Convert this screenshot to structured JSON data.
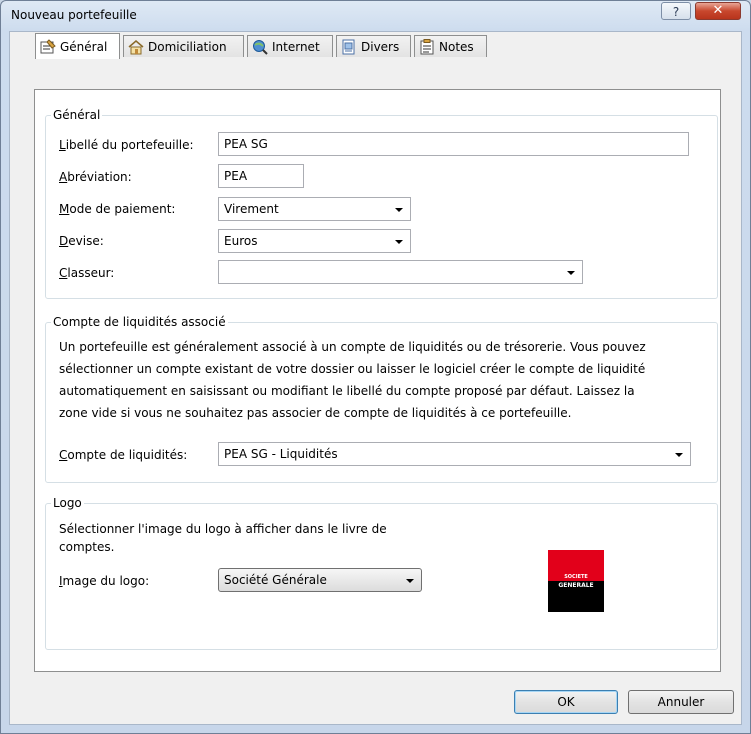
{
  "window": {
    "title": "Nouveau portefeuille",
    "help_label": "?",
    "close_label": "✕"
  },
  "tabs": [
    {
      "label": "Général",
      "icon": "general-icon",
      "active": true
    },
    {
      "label": "Domiciliation",
      "icon": "house-icon",
      "active": false
    },
    {
      "label": "Internet",
      "icon": "internet-icon",
      "active": false
    },
    {
      "label": "Divers",
      "icon": "divers-icon",
      "active": false
    },
    {
      "label": "Notes",
      "icon": "notes-icon",
      "active": false
    }
  ],
  "general": {
    "title": "Général",
    "libelle": {
      "label_hot": "L",
      "label_rest": "ibellé du portefeuille:",
      "value": "PEA SG"
    },
    "abreviation": {
      "label_hot": "A",
      "label_rest": "bréviation:",
      "value": "PEA"
    },
    "mode_paiement": {
      "label_hot": "M",
      "label_rest": "ode de paiement:",
      "value": "Virement"
    },
    "devise": {
      "label_hot": "D",
      "label_rest": "evise:",
      "value": "Euros"
    },
    "classeur": {
      "label_hot": "C",
      "label_rest": "lasseur:",
      "value": ""
    }
  },
  "liquidites": {
    "title": "Compte de liquidités associé",
    "description_lines": [
      "Un portefeuille est généralement associé à un compte de liquidités ou de trésorerie. Vous pouvez",
      "sélectionner un compte existant de votre dossier ou laisser le logiciel créer le compte de liquidité",
      "automatiquement en saisissant ou modifiant le libellé du compte proposé par défaut. Laissez la",
      "zone vide si vous ne souhaitez pas associer de compte de liquidités à ce portefeuille."
    ],
    "compte": {
      "label_hot": "C",
      "label_rest": "ompte de liquidités:",
      "value": "PEA SG - Liquidités"
    }
  },
  "logo": {
    "title": "Logo",
    "description_lines": [
      "Sélectionner l'image du logo à afficher dans le livre de",
      "comptes."
    ],
    "image": {
      "label_hot": "I",
      "label_rest": "mage du logo:",
      "value": "Société Générale"
    },
    "logo_text_top": "SOCIETE",
    "logo_text_bottom": "GENERALE"
  },
  "buttons": {
    "ok": "OK",
    "cancel": "Annuler"
  },
  "colors": {
    "logo_red": "#e2001a",
    "logo_black": "#000000",
    "close_red": "#c8472d"
  }
}
